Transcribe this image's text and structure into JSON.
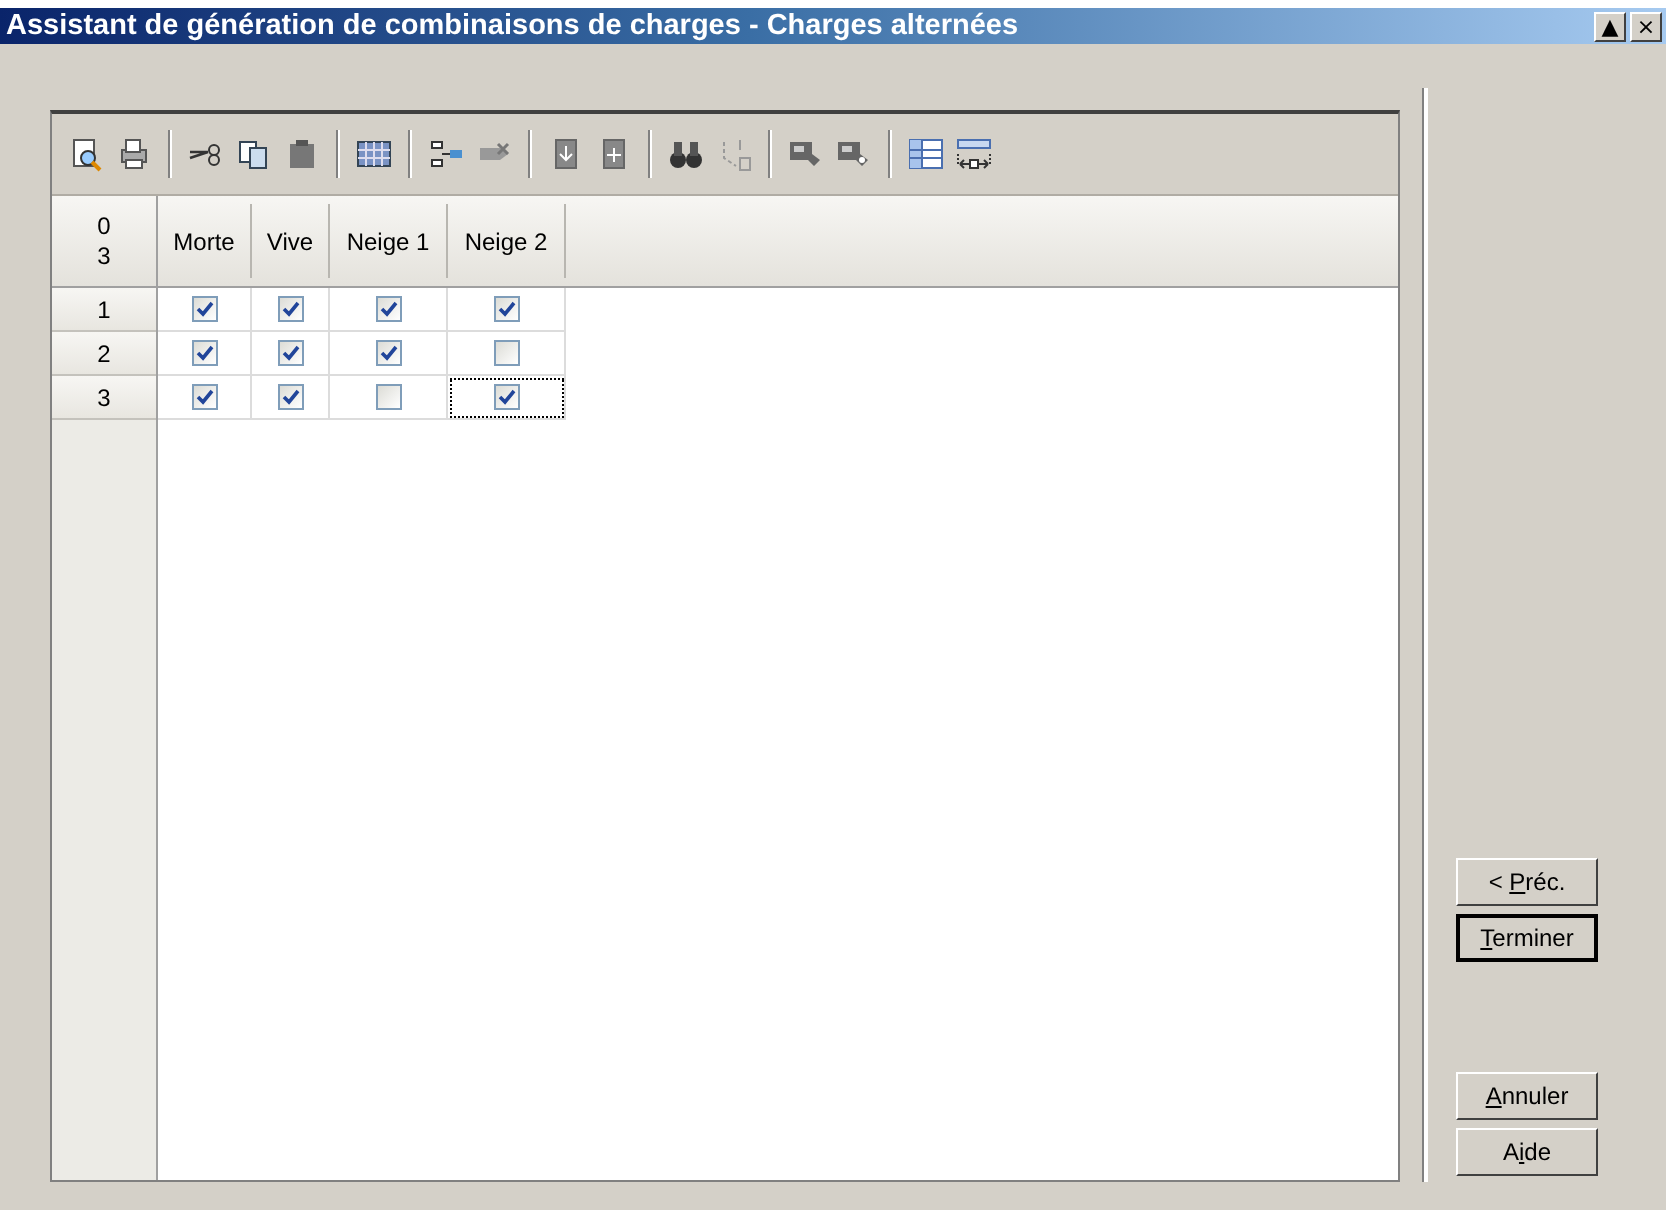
{
  "window": {
    "title": "Assistant de génération de combinaisons de charges - Charges alternées",
    "controls": [
      "▲",
      "×"
    ]
  },
  "grid": {
    "corner": [
      "0",
      "3"
    ],
    "columns": [
      "Morte",
      "Vive",
      "Neige 1",
      "Neige 2"
    ],
    "rows": [
      {
        "label": "1",
        "cells": [
          {
            "checked": true,
            "focused": false
          },
          {
            "checked": true,
            "focused": false
          },
          {
            "checked": true,
            "focused": false
          },
          {
            "checked": true,
            "focused": false
          }
        ]
      },
      {
        "label": "2",
        "cells": [
          {
            "checked": true,
            "focused": false
          },
          {
            "checked": true,
            "focused": false
          },
          {
            "checked": true,
            "focused": false
          },
          {
            "checked": false,
            "focused": false
          }
        ]
      },
      {
        "label": "3",
        "cells": [
          {
            "checked": true,
            "focused": false
          },
          {
            "checked": true,
            "focused": false
          },
          {
            "checked": false,
            "focused": false
          },
          {
            "checked": true,
            "focused": true
          }
        ]
      }
    ]
  },
  "nav_buttons": [
    {
      "pre": "< ",
      "key": "P",
      "post": "réc.",
      "default": false
    },
    {
      "key": "T",
      "post": "erminer",
      "default": true
    }
  ],
  "end_buttons": [
    {
      "key": "A",
      "post": "nnuler",
      "default": false
    },
    {
      "pre": "A",
      "key": "i",
      "post": "de",
      "default": false
    }
  ]
}
